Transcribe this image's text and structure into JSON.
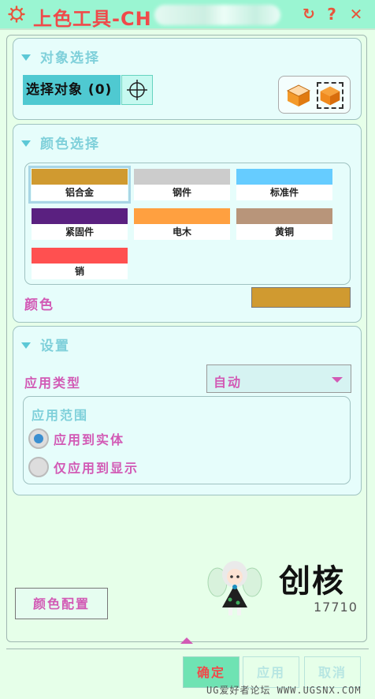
{
  "titlebar": {
    "title": "上色工具-CH",
    "icon": "gear-icon",
    "reset_glyph": "↻",
    "help_glyph": "?",
    "close_glyph": "✕"
  },
  "object_group": {
    "title": "对象选择",
    "select_label": "选择对象 (0)",
    "crosshair_icon": "crosshair-icon",
    "type_icons": [
      "solid-body-icon",
      "display-body-icon"
    ]
  },
  "color_group": {
    "title": "颜色选择",
    "swatches": [
      {
        "name": "铝合金",
        "color": "#d09a30"
      },
      {
        "name": "钢件",
        "color": "#cccccc"
      },
      {
        "name": "标准件",
        "color": "#66ccff"
      },
      {
        "name": "紧固件",
        "color": "#5a2080"
      },
      {
        "name": "电木",
        "color": "#ffa040"
      },
      {
        "name": "黄铜",
        "color": "#b8957a"
      },
      {
        "name": "销",
        "color": "#ff5050"
      }
    ],
    "selected": "铝合金",
    "color_label": "颜色",
    "current_color": "#d09a30"
  },
  "settings_group": {
    "title": "设置",
    "apply_type_label": "应用类型",
    "apply_type_value": "自动",
    "range_title": "应用范围",
    "radio_solid": "应用到实体",
    "radio_display": "仅应用到显示",
    "radio_selected": "应用到实体"
  },
  "brand": {
    "text": "创核",
    "number": "17710"
  },
  "buttons": {
    "color_config": "颜色配置",
    "ok": "确定",
    "apply": "应用",
    "cancel": "取消"
  },
  "watermark": "UG爱好者论坛 WWW.UGSNX.COM",
  "colors": {
    "titlebar": "#9af5d2",
    "accent_pink": "#d25ab5",
    "accent_cyan": "#7fd0da",
    "title_red": "#f04a4a"
  }
}
